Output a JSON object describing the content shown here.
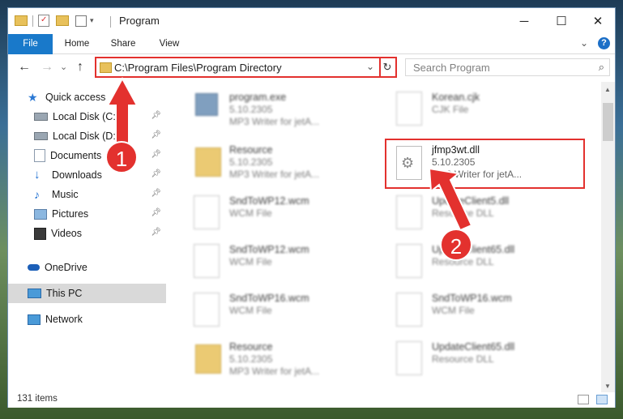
{
  "window": {
    "title": "Program",
    "minimize": "─",
    "maximize": "☐",
    "close": "✕"
  },
  "ribbon": {
    "tabs": [
      "File",
      "Home",
      "Share",
      "View"
    ],
    "expand_icon": "chevron-down-icon",
    "help_label": "?"
  },
  "nav": {
    "back": "←",
    "forward": "→",
    "recent": "⌄",
    "up": "↑",
    "address": "C:\\Program Files\\Program Directory",
    "refresh": "↻",
    "search_placeholder": "Search Program"
  },
  "sidebar": {
    "items": [
      {
        "label": "Quick access",
        "icon": "star-icon"
      },
      {
        "label": "Local Disk (C:)",
        "icon": "drive-icon"
      },
      {
        "label": "Local Disk (D:)",
        "icon": "drive-icon"
      },
      {
        "label": "Documents",
        "icon": "documents-icon"
      },
      {
        "label": "Downloads",
        "icon": "downloads-icon"
      },
      {
        "label": "Music",
        "icon": "music-icon"
      },
      {
        "label": "Pictures",
        "icon": "pictures-icon"
      },
      {
        "label": "Videos",
        "icon": "videos-icon"
      },
      {
        "label": "OneDrive",
        "icon": "cloud-icon"
      },
      {
        "label": "This PC",
        "icon": "pc-icon"
      },
      {
        "label": "Network",
        "icon": "network-icon"
      }
    ]
  },
  "files": [
    {
      "name": "program.exe",
      "line1": "5.10.2305",
      "line2": "MP3 Writer for jetA...",
      "type": "exe"
    },
    {
      "name": "Korean.cjk",
      "line1": "CJK File",
      "line2": "",
      "type": "doc"
    },
    {
      "name": "Resource",
      "line1": "5.10.2305",
      "line2": "MP3 Writer for jetA...",
      "type": "folder"
    },
    {
      "name": "jfmp3wt.dll",
      "line1": "5.10.2305",
      "line2": "MP3 Writer for jetA...",
      "type": "dll"
    },
    {
      "name": "SndToWP12.wcm",
      "line1": "WCM File",
      "line2": "",
      "type": "doc"
    },
    {
      "name": "UpdateClient5.dll",
      "line1": "Resource DLL",
      "line2": "",
      "type": "dll"
    },
    {
      "name": "SndToWP12.wcm",
      "line1": "WCM File",
      "line2": "",
      "type": "doc"
    },
    {
      "name": "UpdateClient65.dll",
      "line1": "Resource DLL",
      "line2": "",
      "type": "dll"
    },
    {
      "name": "SndToWP16.wcm",
      "line1": "WCM File",
      "line2": "",
      "type": "doc"
    },
    {
      "name": "SndToWP16.wcm",
      "line1": "WCM File",
      "line2": "",
      "type": "doc"
    },
    {
      "name": "Resource",
      "line1": "5.10.2305",
      "line2": "MP3 Writer for jetA...",
      "type": "folder"
    },
    {
      "name": "UpdateClient65.dll",
      "line1": "Resource DLL",
      "line2": "",
      "type": "dll"
    }
  ],
  "status": {
    "items_count": "131 items"
  },
  "annotations": {
    "step1": "1",
    "step2": "2"
  },
  "colors": {
    "accent": "#1979ca",
    "highlight": "#e3312e",
    "selected": "#d9d9d9"
  }
}
